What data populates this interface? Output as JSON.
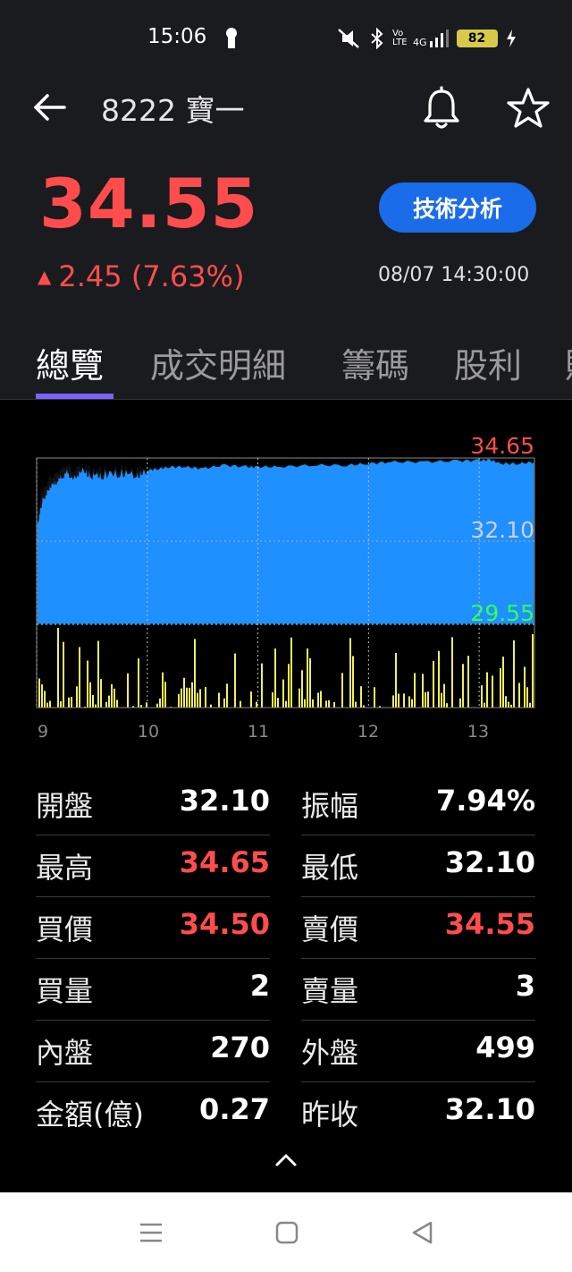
{
  "status_bar": {
    "time": "15:06",
    "volte": "Vo LTE",
    "network": "4G",
    "battery": "82"
  },
  "header": {
    "title": "8222 寶一"
  },
  "quote": {
    "price": "34.55",
    "change": "2.45 (7.63%)",
    "timestamp": "08/07 14:30:00",
    "tech_button": "技術分析"
  },
  "tabs": [
    {
      "label": "總覽",
      "active": true
    },
    {
      "label": "成交明細",
      "active": false
    },
    {
      "label": "籌碼",
      "active": false
    },
    {
      "label": "股利",
      "active": false
    },
    {
      "label": "財",
      "active": false
    }
  ],
  "chart_data": {
    "type": "area",
    "ylim": [
      29.55,
      34.65
    ],
    "y_labels": {
      "high": "34.65",
      "mid": "32.10",
      "low": "29.55"
    },
    "x_labels": [
      "9",
      "10",
      "11",
      "12",
      "13"
    ],
    "x_range": [
      9,
      13.5
    ],
    "price_series": [
      [
        9.0,
        32.7
      ],
      [
        9.03,
        33.1
      ],
      [
        9.05,
        33.5
      ],
      [
        9.08,
        33.6
      ],
      [
        9.12,
        33.9
      ],
      [
        9.17,
        34.0
      ],
      [
        9.22,
        34.15
      ],
      [
        9.28,
        34.3
      ],
      [
        9.33,
        34.1
      ],
      [
        9.4,
        34.35
      ],
      [
        9.5,
        34.2
      ],
      [
        9.6,
        34.2
      ],
      [
        9.75,
        34.25
      ],
      [
        9.9,
        34.2
      ],
      [
        10.0,
        34.3
      ],
      [
        10.1,
        34.35
      ],
      [
        10.2,
        34.4
      ],
      [
        10.35,
        34.4
      ],
      [
        10.5,
        34.35
      ],
      [
        10.7,
        34.45
      ],
      [
        10.9,
        34.4
      ],
      [
        11.0,
        34.4
      ],
      [
        11.2,
        34.4
      ],
      [
        11.5,
        34.45
      ],
      [
        11.8,
        34.45
      ],
      [
        12.0,
        34.5
      ],
      [
        12.2,
        34.55
      ],
      [
        12.5,
        34.55
      ],
      [
        12.8,
        34.58
      ],
      [
        13.0,
        34.6
      ],
      [
        13.1,
        34.62
      ],
      [
        13.2,
        34.5
      ],
      [
        13.35,
        34.5
      ],
      [
        13.5,
        34.55
      ]
    ],
    "volume_seed": 7
  },
  "stats": [
    {
      "label": "開盤",
      "value": "32.10",
      "tone": "neutral"
    },
    {
      "label": "振幅",
      "value": "7.94%",
      "tone": "neutral"
    },
    {
      "label": "最高",
      "value": "34.65",
      "tone": "up"
    },
    {
      "label": "最低",
      "value": "32.10",
      "tone": "neutral"
    },
    {
      "label": "買價",
      "value": "34.50",
      "tone": "up"
    },
    {
      "label": "賣價",
      "value": "34.55",
      "tone": "up"
    },
    {
      "label": "買量",
      "value": "2",
      "tone": "neutral"
    },
    {
      "label": "賣量",
      "value": "3",
      "tone": "neutral"
    },
    {
      "label": "內盤",
      "value": "270",
      "tone": "neutral"
    },
    {
      "label": "外盤",
      "value": "499",
      "tone": "neutral"
    },
    {
      "label": "金額(億)",
      "value": "0.27",
      "tone": "neutral"
    },
    {
      "label": "昨收",
      "value": "32.10",
      "tone": "neutral"
    }
  ],
  "colors": {
    "up": "#ff4d4d",
    "neutral": "#ffffff",
    "area": "#1e90ff",
    "volume": "#f0f05a",
    "accent": "#7b61ff",
    "button": "#1a6ce8"
  }
}
